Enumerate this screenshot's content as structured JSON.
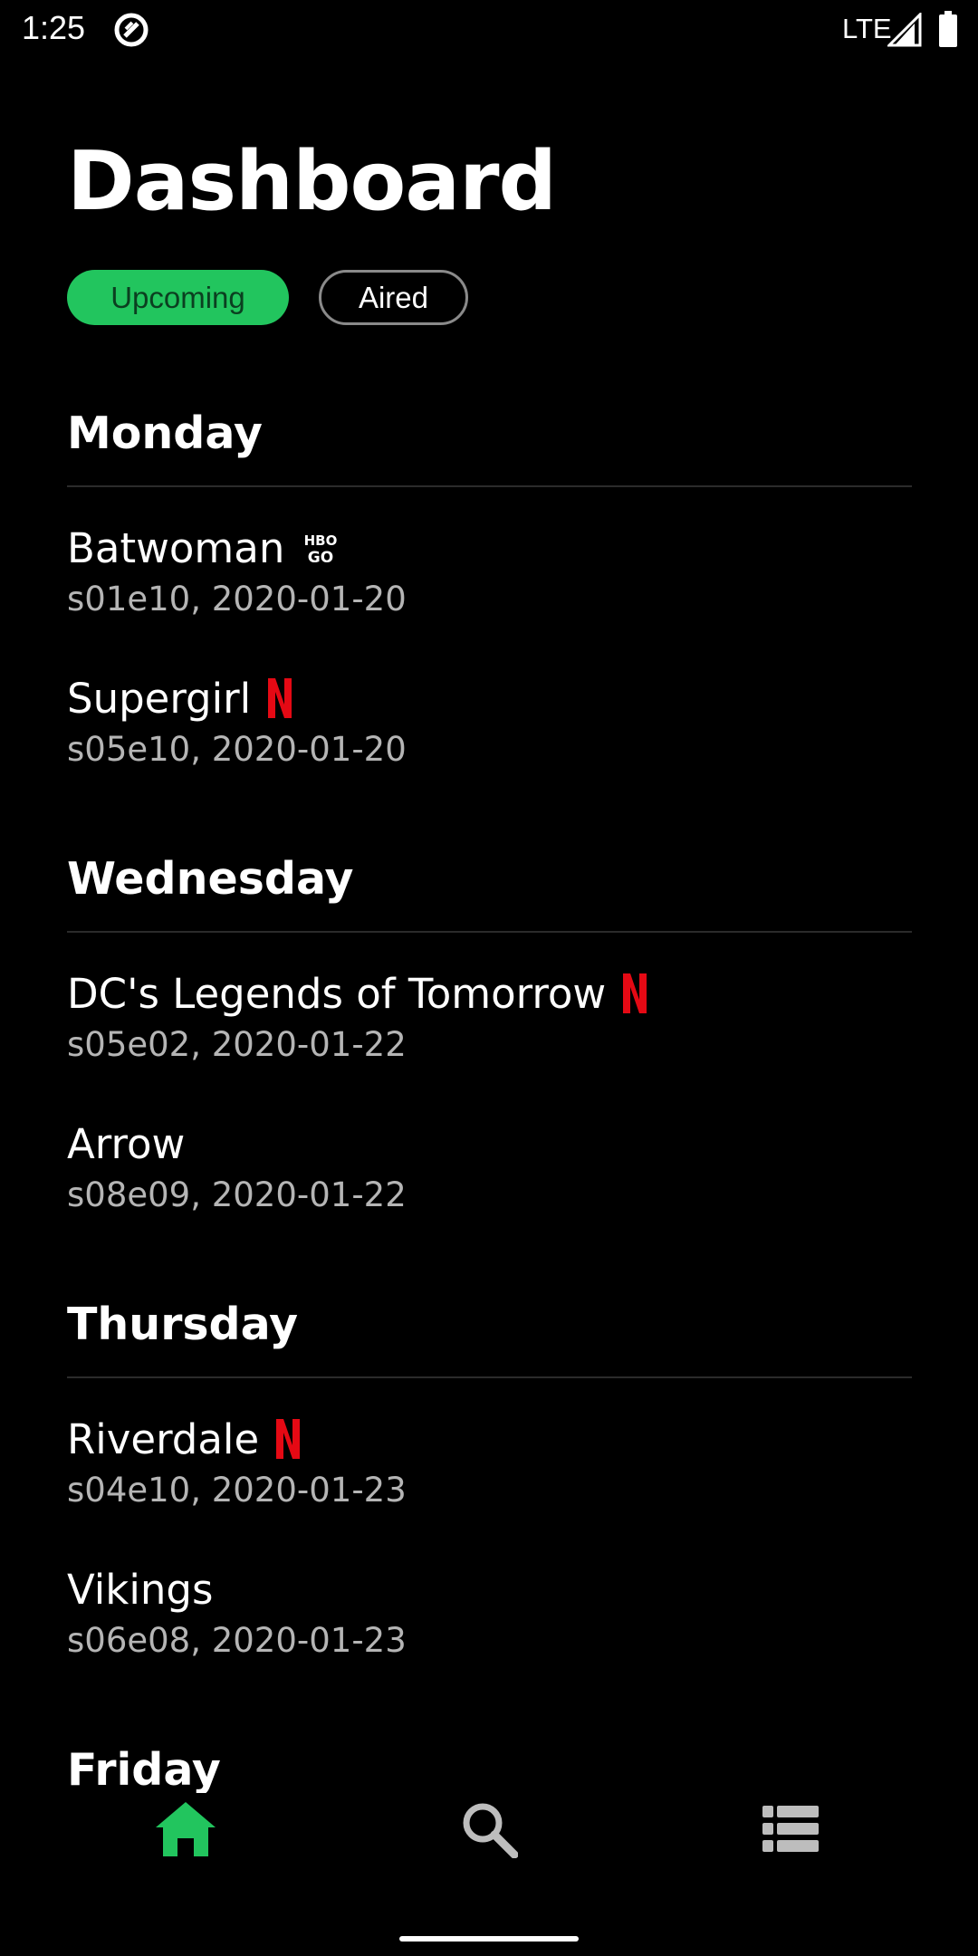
{
  "status_bar": {
    "time": "1:25",
    "network": "LTE",
    "icons": [
      "app-notification-icon",
      "signal-icon",
      "battery-icon"
    ]
  },
  "header": {
    "title": "Dashboard"
  },
  "filters": {
    "upcoming": "Upcoming",
    "aired": "Aired",
    "selected": "Upcoming"
  },
  "schedule": [
    {
      "day": "Monday",
      "shows": [
        {
          "title": "Batwoman",
          "meta": "s01e10, 2020-01-20",
          "provider": "hbo-go"
        },
        {
          "title": "Supergirl",
          "meta": "s05e10, 2020-01-20",
          "provider": "netflix"
        }
      ]
    },
    {
      "day": "Wednesday",
      "shows": [
        {
          "title": "DC's Legends of Tomorrow",
          "meta": "s05e02, 2020-01-22",
          "provider": "netflix"
        },
        {
          "title": "Arrow",
          "meta": "s08e09, 2020-01-22",
          "provider": ""
        }
      ]
    },
    {
      "day": "Thursday",
      "shows": [
        {
          "title": "Riverdale",
          "meta": "s04e10, 2020-01-23",
          "provider": "netflix"
        },
        {
          "title": "Vikings",
          "meta": "s06e08, 2020-01-23",
          "provider": ""
        }
      ]
    },
    {
      "day": "Friday",
      "shows": []
    }
  ],
  "bottom_nav": {
    "items": [
      "home-icon",
      "search-icon",
      "list-icon"
    ],
    "active": "home-icon"
  },
  "colors": {
    "accent": "#22c55e",
    "background": "#000000",
    "netflix": "#e50914",
    "secondary_text": "#b5b5b5"
  }
}
